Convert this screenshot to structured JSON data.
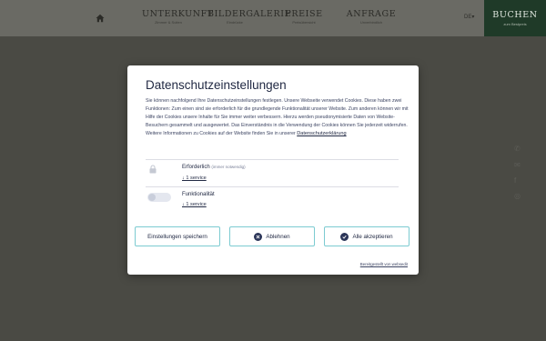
{
  "nav": {
    "home_icon": "home-icon",
    "items": [
      {
        "title": "UNTERKUNFT",
        "sub": "Zimmer & Suiten"
      },
      {
        "title": "BILDERGALERIE",
        "sub": "Eindrücke"
      },
      {
        "title": "PREISE",
        "sub": "Preisübersicht"
      },
      {
        "title": "ANFRAGE",
        "sub": "Unverbindlich"
      }
    ],
    "language": "DE",
    "book": {
      "title": "BUCHEN",
      "sub": "zum Bestpreis"
    }
  },
  "colors": {
    "header_bg": "#6a6a64",
    "overlay_bg": "#4a4a44",
    "book_bg": "#1f3a28",
    "modal_text": "#222a44",
    "button_border": "#7ccbd1",
    "button_icon_bg": "#2b3558"
  },
  "consent": {
    "title": "Datenschutzeinstellungen",
    "description": "Sie können nachfolgend Ihre Datenschutzeinstellungen festlegen. Unsere Webseite verwendet Cookies. Diese haben zwei Funktionen: Zum einen sind sie erforderlich für die grundlegende Funktionalität unserer Website. Zum anderen können wir mit Hilfe der Cookies unsere Inhalte für Sie immer weiter verbessern. Hierzu werden pseudonymisierte Daten von Website-Besuchern gesammelt und ausgewertet. Das Einverständnis in die Verwendung der Cookies können Sie jederzeit widerrufen. Weitere Informationen zu Cookies auf der Website finden Sie in unserer",
    "privacy_link": "Datenschutzerklärung",
    "categories": [
      {
        "name": "Erforderlich",
        "note": "(immer notwendig)",
        "services": "↓ 1 service",
        "icon": "lock-icon"
      },
      {
        "name": "Funktionalität",
        "note": "",
        "services": "↓ 1 service",
        "enabled": false
      }
    ],
    "buttons": {
      "save": "Einstellungen speichern",
      "reject": "Ablehnen",
      "accept_all": "Alle akzeptieren"
    },
    "powered_by": "Bereitgestellt von websedit"
  }
}
